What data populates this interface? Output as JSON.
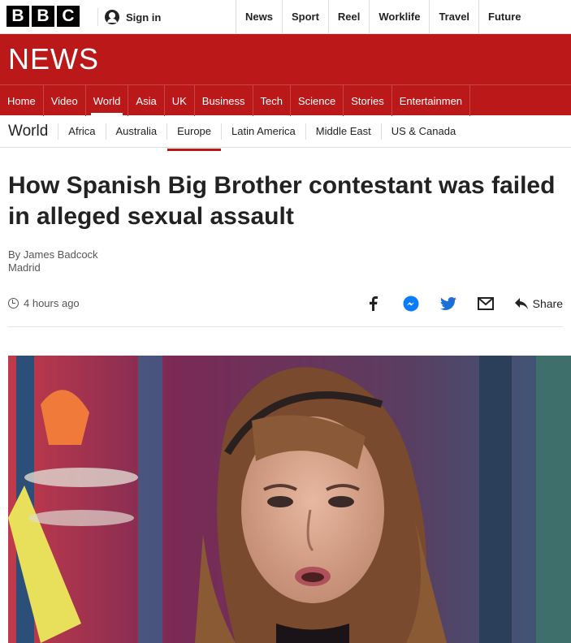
{
  "brand": {
    "logo_letters": [
      "B",
      "B",
      "C"
    ]
  },
  "account": {
    "signin_label": "Sign in"
  },
  "top_nav": [
    "News",
    "Sport",
    "Reel",
    "Worklife",
    "Travel",
    "Future"
  ],
  "banner": {
    "title": "NEWS"
  },
  "section_nav": {
    "items": [
      "Home",
      "Video",
      "World",
      "Asia",
      "UK",
      "Business",
      "Tech",
      "Science",
      "Stories",
      "Entertainmen"
    ],
    "active": "World"
  },
  "sub_nav": {
    "title": "World",
    "items": [
      "Africa",
      "Australia",
      "Europe",
      "Latin America",
      "Middle East",
      "US & Canada"
    ],
    "active": "Europe"
  },
  "article": {
    "headline": "How Spanish Big Brother contestant was failed in alleged sexual assault",
    "byline": "By James Badcock",
    "location": "Madrid",
    "timestamp": "4 hours ago",
    "share_label": "Share"
  },
  "colors": {
    "brand_red": "#bb1919",
    "text": "#222222"
  },
  "icons": [
    "user-icon",
    "clock-icon",
    "facebook-icon",
    "messenger-icon",
    "twitter-icon",
    "email-icon",
    "share-icon"
  ]
}
